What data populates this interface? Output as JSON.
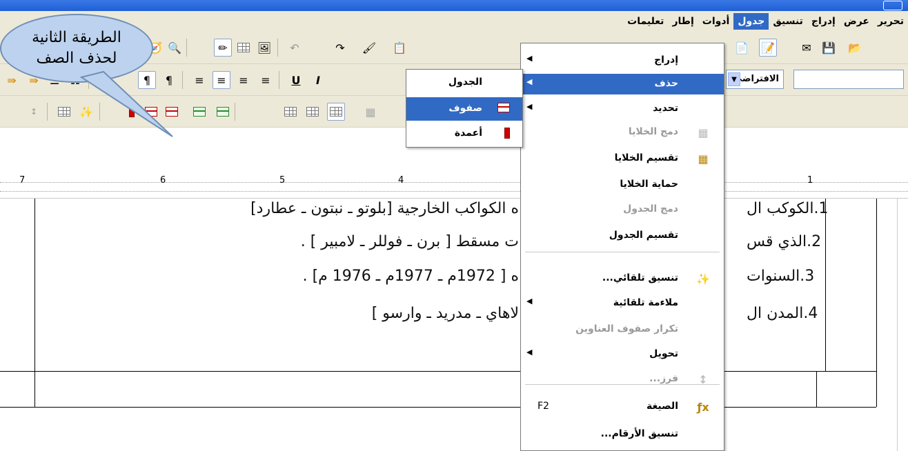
{
  "menubar": {
    "items": [
      "تحرير",
      "عرض",
      "إدراج",
      "تنسيق",
      "جدول",
      "أدوات",
      "إطار",
      "تعليمات"
    ],
    "active": "جدول"
  },
  "toolbar": {
    "style_value": "الافتراضي"
  },
  "ruler": {
    "numbers": [
      "7",
      "6",
      "5",
      "4",
      "1"
    ]
  },
  "callout": {
    "line1": "الطريقة الثانية",
    "line2": "لحذف الصف"
  },
  "table_menu": {
    "items": [
      {
        "label": "إدراج",
        "submenu": true,
        "enabled": true,
        "icon": ""
      },
      {
        "label": "حذف",
        "submenu": true,
        "enabled": true,
        "highlighted": true,
        "icon": ""
      },
      {
        "label": "تحديد",
        "submenu": true,
        "enabled": true,
        "icon": ""
      },
      {
        "label": "دمج الخلايا",
        "enabled": false,
        "icon": "merge-cells-icon"
      },
      {
        "label": "تقسيم الخلايا",
        "enabled": true,
        "icon": "split-cells-icon"
      },
      {
        "label": "حماية الخلايا",
        "enabled": true,
        "icon": ""
      },
      {
        "label": "دمج الجدول",
        "enabled": false,
        "icon": ""
      },
      {
        "label": "تقسيم الجدول",
        "enabled": true,
        "icon": ""
      },
      {
        "label": "تنسيق تلقائي...",
        "enabled": true,
        "icon": "autoformat-icon"
      },
      {
        "label": "ملاءمة تلقائية",
        "submenu": true,
        "enabled": true,
        "icon": ""
      },
      {
        "label": "تكرار صفوف العناوين",
        "enabled": false,
        "icon": ""
      },
      {
        "label": "تحويل",
        "submenu": true,
        "enabled": true,
        "icon": ""
      },
      {
        "label": "فرز...",
        "enabled": false,
        "icon": "sort-icon"
      },
      {
        "label": "الصيغة",
        "enabled": true,
        "icon": "formula-icon",
        "shortcut": "F2"
      },
      {
        "label": "تنسيق الأرقام...",
        "enabled": true,
        "icon": ""
      }
    ]
  },
  "delete_submenu": {
    "items": [
      {
        "label": "الجدول",
        "icon": ""
      },
      {
        "label": "صفوف",
        "icon": "delete-rows-icon",
        "highlighted": true
      },
      {
        "label": "أعمدة",
        "icon": "delete-columns-icon"
      }
    ]
  },
  "document": {
    "lines": [
      {
        "num": "1.",
        "head": "الكوكب ال",
        "tail": "ه الكواكب الخارجية [بلوتو ـ نبتون ـ عطارد]"
      },
      {
        "num": "2.",
        "head": "الذي قس",
        "tail": "ت مسقط [ برن ـ فوللر ـ لامبير ] ."
      },
      {
        "num": "3.",
        "head": "السنوات",
        "tail": "ه [ 1972م ـ 1977م ـ 1976 م] ."
      },
      {
        "num": "4.",
        "head": "المدن ال",
        "tail": "لاهاي ـ مدريد ـ وارسو ]"
      }
    ]
  }
}
